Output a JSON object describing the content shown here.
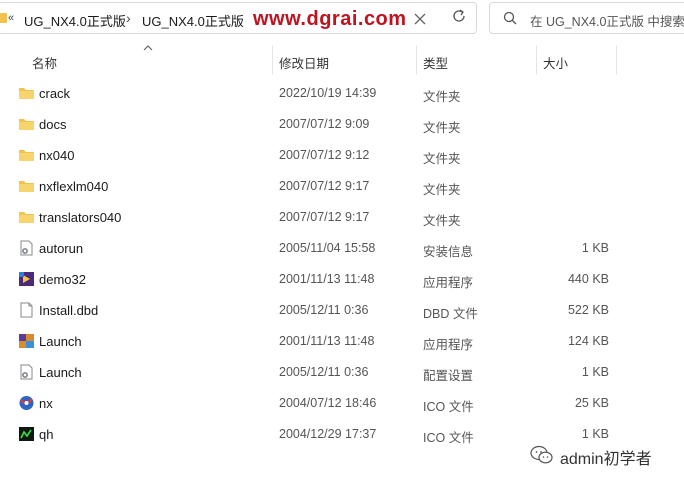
{
  "address_bar": {
    "overflow_chevron": "«",
    "crumbs": [
      "UG_NX4.0正式版",
      "UG_NX4.0正式版"
    ],
    "separator": "›",
    "watermark": "www.dgrai.com"
  },
  "search": {
    "placeholder": "在 UG_NX4.0正式版 中搜索"
  },
  "columns": {
    "name": "名称",
    "date": "修改日期",
    "type": "类型",
    "size": "大小"
  },
  "files": [
    {
      "name": "crack",
      "date": "2022/10/19 14:39",
      "type": "文件夹",
      "size": "",
      "icon": "folder-icon"
    },
    {
      "name": "docs",
      "date": "2007/07/12 9:09",
      "type": "文件夹",
      "size": "",
      "icon": "folder-icon"
    },
    {
      "name": "nx040",
      "date": "2007/07/12 9:12",
      "type": "文件夹",
      "size": "",
      "icon": "folder-icon"
    },
    {
      "name": "nxflexlm040",
      "date": "2007/07/12 9:17",
      "type": "文件夹",
      "size": "",
      "icon": "folder-icon"
    },
    {
      "name": "translators040",
      "date": "2007/07/12 9:17",
      "type": "文件夹",
      "size": "",
      "icon": "folder-icon"
    },
    {
      "name": "autorun",
      "date": "2005/11/04 15:58",
      "type": "安装信息",
      "size": "1 KB",
      "icon": "settings-file-icon"
    },
    {
      "name": "demo32",
      "date": "2001/11/13 11:48",
      "type": "应用程序",
      "size": "440 KB",
      "icon": "app-icon"
    },
    {
      "name": "Install.dbd",
      "date": "2005/12/11 0:36",
      "type": "DBD 文件",
      "size": "522 KB",
      "icon": "file-icon"
    },
    {
      "name": "Launch",
      "date": "2001/11/13 11:48",
      "type": "应用程序",
      "size": "124 KB",
      "icon": "app-icon"
    },
    {
      "name": "Launch",
      "date": "2005/12/11 0:36",
      "type": "配置设置",
      "size": "1 KB",
      "icon": "settings-file-icon"
    },
    {
      "name": "nx",
      "date": "2004/07/12 18:46",
      "type": "ICO 文件",
      "size": "25 KB",
      "icon": "nx-ico-icon"
    },
    {
      "name": "qh",
      "date": "2004/12/29 17:37",
      "type": "ICO 文件",
      "size": "1 KB",
      "icon": "qh-ico-icon"
    }
  ],
  "wechat_watermark": {
    "text": "admin初学者"
  }
}
